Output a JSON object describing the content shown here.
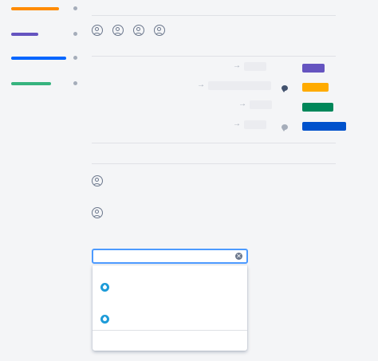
{
  "sidebar": {
    "items": [
      {
        "name": "sidebar-item-orange",
        "color": "#ff8b00"
      },
      {
        "name": "sidebar-item-purple",
        "color": "#6554c0"
      },
      {
        "name": "sidebar-item-blue",
        "color": "#0065ff"
      },
      {
        "name": "sidebar-item-green",
        "color": "#36b37e"
      }
    ]
  },
  "colors": {
    "background": "#f4f5f7",
    "divider": "#dfe1e6",
    "placeholder": "#ebecf0",
    "focus_border": "#4c9aff",
    "menu_icon": "#1d9bd8"
  },
  "watchers": {
    "icons": [
      "person-icon",
      "person-icon",
      "person-icon",
      "person-icon"
    ]
  },
  "transitions": {
    "rows": [
      {
        "arrow": "→",
        "has_comment": false,
        "comment_color": "",
        "status_color": "#6554c0"
      },
      {
        "arrow": "→",
        "has_comment": true,
        "comment_color": "#42526e",
        "status_color": "#ffab00"
      },
      {
        "arrow": "→",
        "has_comment": false,
        "comment_color": "",
        "status_color": "#00875a"
      },
      {
        "arrow": "→",
        "has_comment": true,
        "comment_color": "#a5adba",
        "status_color": "#0052cc"
      }
    ]
  },
  "people": {
    "icons": [
      "person-icon",
      "person-icon"
    ]
  },
  "picker": {
    "value": "",
    "placeholder": "",
    "clear_glyph": "✕",
    "options": [
      {
        "label": "",
        "icon": "droplet-icon"
      },
      {
        "label": "",
        "icon": "droplet-icon"
      }
    ],
    "footer_label": ""
  }
}
